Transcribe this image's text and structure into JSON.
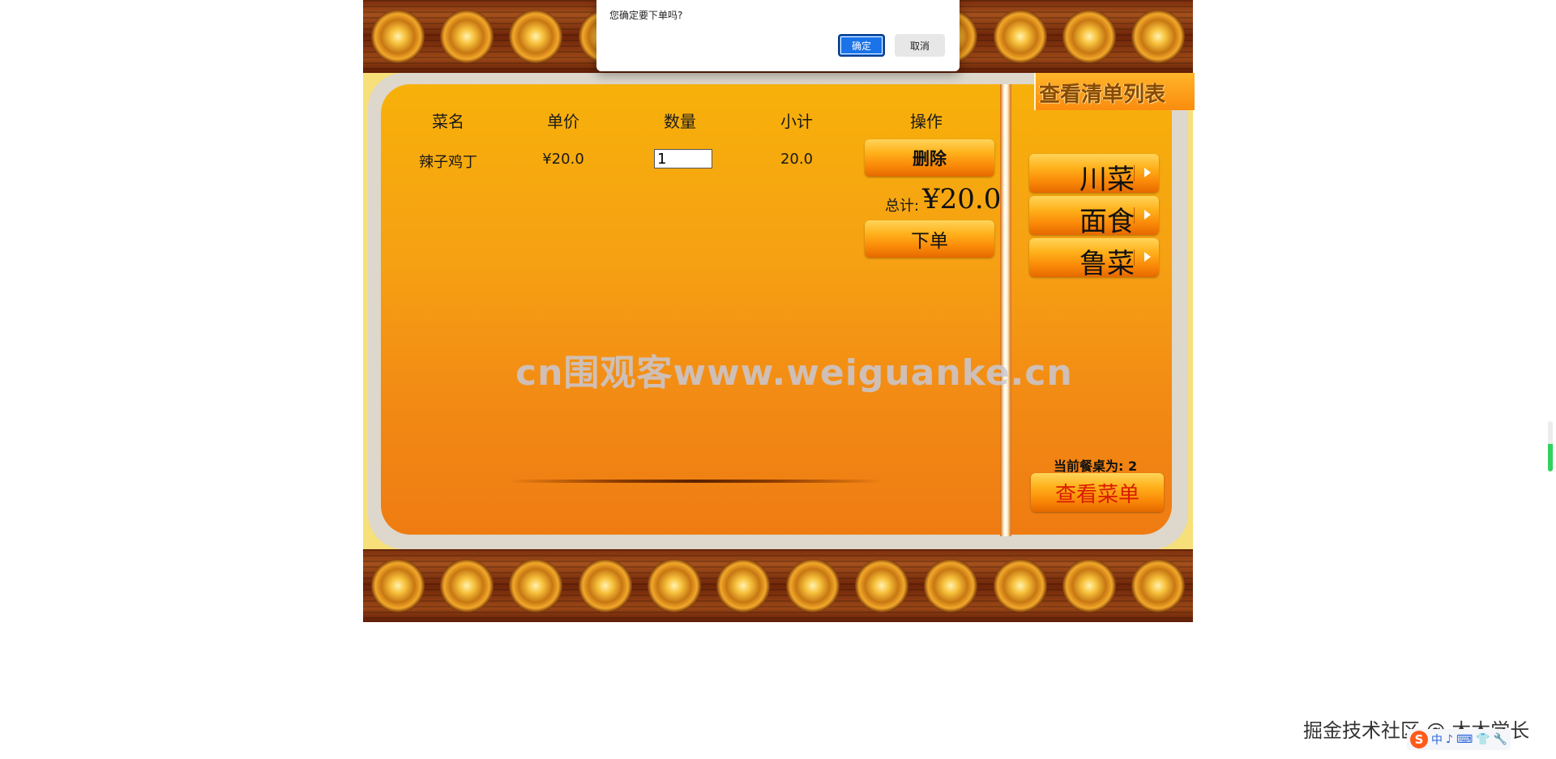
{
  "dialog": {
    "message": "您确定要下单吗?",
    "ok_label": "确定",
    "cancel_label": "取消"
  },
  "order_table": {
    "headers": [
      "菜名",
      "单价",
      "数量",
      "小计",
      "操作"
    ],
    "rows": [
      {
        "name": "辣子鸡丁",
        "price": "¥20.0",
        "quantity": "1",
        "subtotal": "20.0",
        "action": "删除"
      }
    ]
  },
  "summary": {
    "total_label": "总计:",
    "total_amount": "¥20.0",
    "submit_label": "下单"
  },
  "sidebar": {
    "list_tab_label": "查看清单列表",
    "categories": [
      "川菜",
      "面食",
      "鲁菜"
    ],
    "table_label": "当前餐桌为: 2",
    "menu_button_label": "查看菜单"
  },
  "watermark": "cn围观客www.weiguanke.cn",
  "footer": {
    "community_text": "掘金技术社区 @ 木木学长",
    "ime_tray": [
      "S",
      "中",
      "♪",
      "⌨",
      "👕",
      "🔧"
    ]
  },
  "colors": {
    "panel_orange": "#f6a013",
    "button_orange": "#fb8a08",
    "dialog_primary": "#1a73e8",
    "menu_text_red": "#d81c00",
    "border_wood": "#7a2c0c"
  }
}
